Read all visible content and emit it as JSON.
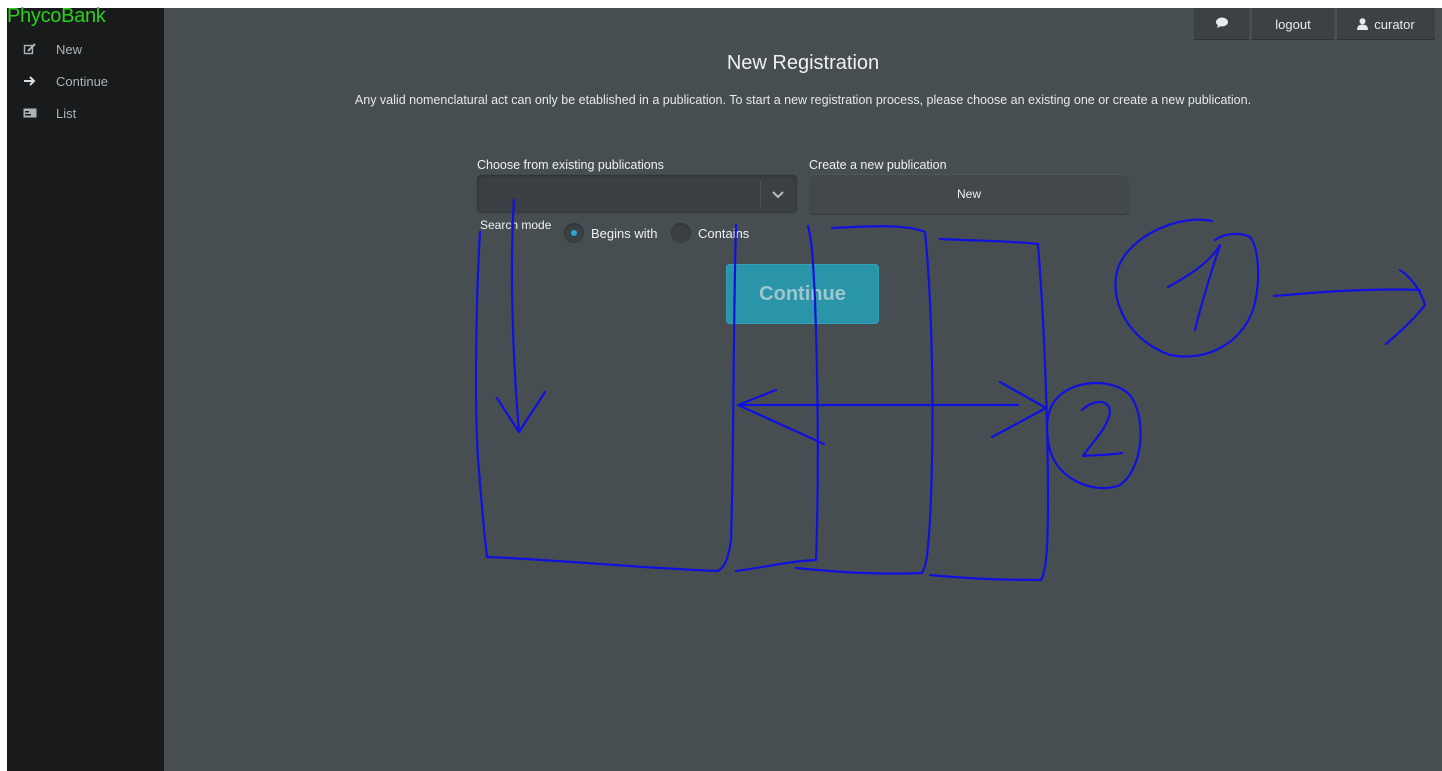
{
  "app": {
    "brand": "PhycoBank",
    "accent_color": "#2bd01b",
    "background_color": "#474e52"
  },
  "sidebar": {
    "items": [
      {
        "label": "New",
        "icon": "edit-icon"
      },
      {
        "label": "Continue",
        "icon": "arrow-right-icon"
      },
      {
        "label": "List",
        "icon": "list-card-icon"
      }
    ]
  },
  "topbar": {
    "chat_icon": "chat-bubble-icon",
    "logout_label": "logout",
    "user_label": "curator",
    "user_icon": "user-icon"
  },
  "main": {
    "title": "New Registration",
    "subtitle": "Any valid nomenclatural act can only be etablished in a publication. To start a new registration process, please choose an existing one or create a new publication.",
    "choose_label": "Choose from existing publications",
    "choose_value": "",
    "create_label": "Create a new publication",
    "new_button": "New",
    "search_mode_label": "Search mode",
    "radio_begins": "Begins with",
    "radio_contains": "Contains",
    "radio_selected": "Begins with",
    "continue_button": "Continue",
    "continue_color": "#2a95a8"
  },
  "annotations": {
    "marker_1": "1",
    "marker_2": "2",
    "ink_color": "#1010e0"
  }
}
